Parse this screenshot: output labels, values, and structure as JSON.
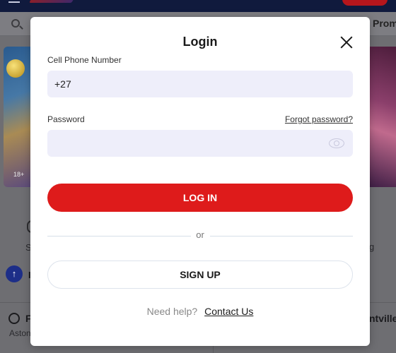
{
  "background": {
    "nav_promo_label": "Prom",
    "age_badge": "18+",
    "left_column_text_1": "S",
    "left_column_badge_text": "",
    "left_column_text_2": "I",
    "right_column_text_1": "g",
    "bottom_left_title": "F",
    "bottom_left_subtitle": "Aston",
    "bottom_right_title": "ntville"
  },
  "login_modal": {
    "title": "Login",
    "phone_label": "Cell Phone Number",
    "phone_value": "+27",
    "password_label": "Password",
    "password_value": "",
    "forgot_password_label": "Forgot password?",
    "login_button_label": "LOG IN",
    "or_label": "or",
    "signup_button_label": "SIGN UP",
    "help_text": "Need help?",
    "contact_link_label": "Contact Us"
  },
  "colors": {
    "primary_red": "#de1b1b",
    "input_background": "#eeeefa",
    "top_nav": "#101a3d"
  },
  "icons": [
    "close-icon",
    "eye-icon",
    "search-icon",
    "menu-icon"
  ]
}
